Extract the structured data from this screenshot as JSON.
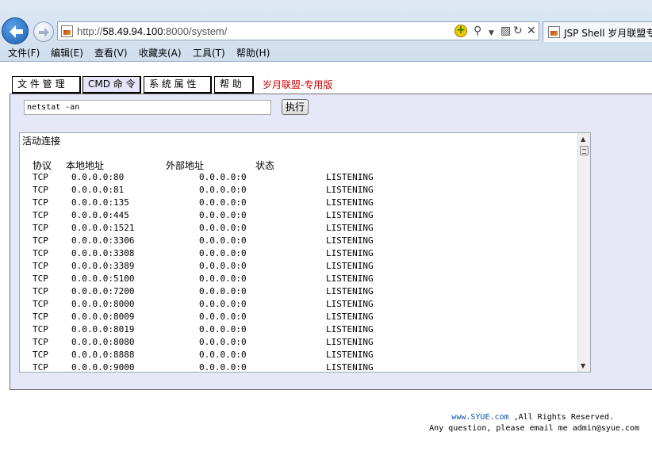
{
  "browser": {
    "url_prefix": "http://",
    "url_host": "58.49.94.100",
    "url_rest": ":8000/system/",
    "tab_title": "JSP Shell 岁月联盟专",
    "icons": [
      "back-arrow-icon",
      "forward-arrow-icon",
      "page-icon",
      "compat-view-icon",
      "search-icon",
      "dropdown-icon",
      "split-view-icon",
      "refresh-icon",
      "stop-icon"
    ]
  },
  "menu": [
    "文件(F)",
    "编辑(E)",
    "查看(V)",
    "收藏夹(A)",
    "工具(T)",
    "帮助(H)"
  ],
  "nav": {
    "items": [
      "文 件 管 理",
      "CMD 命 令",
      "系 统 属 性",
      "帮 助"
    ],
    "brand": "岁月联盟-专用版"
  },
  "command": {
    "value": "netstat -an",
    "run_label": "执行"
  },
  "output": {
    "title": "活动连接",
    "headers": [
      "协议",
      "本地地址",
      "外部地址",
      "状态"
    ],
    "rows": [
      [
        "TCP",
        "0.0.0.0:80",
        "0.0.0.0:0",
        "LISTENING"
      ],
      [
        "TCP",
        "0.0.0.0:81",
        "0.0.0.0:0",
        "LISTENING"
      ],
      [
        "TCP",
        "0.0.0.0:135",
        "0.0.0.0:0",
        "LISTENING"
      ],
      [
        "TCP",
        "0.0.0.0:445",
        "0.0.0.0:0",
        "LISTENING"
      ],
      [
        "TCP",
        "0.0.0.0:1521",
        "0.0.0.0:0",
        "LISTENING"
      ],
      [
        "TCP",
        "0.0.0.0:3306",
        "0.0.0.0:0",
        "LISTENING"
      ],
      [
        "TCP",
        "0.0.0.0:3308",
        "0.0.0.0:0",
        "LISTENING"
      ],
      [
        "TCP",
        "0.0.0.0:3389",
        "0.0.0.0:0",
        "LISTENING"
      ],
      [
        "TCP",
        "0.0.0.0:5100",
        "0.0.0.0:0",
        "LISTENING"
      ],
      [
        "TCP",
        "0.0.0.0:7200",
        "0.0.0.0:0",
        "LISTENING"
      ],
      [
        "TCP",
        "0.0.0.0:8000",
        "0.0.0.0:0",
        "LISTENING"
      ],
      [
        "TCP",
        "0.0.0.0:8009",
        "0.0.0.0:0",
        "LISTENING"
      ],
      [
        "TCP",
        "0.0.0.0:8019",
        "0.0.0.0:0",
        "LISTENING"
      ],
      [
        "TCP",
        "0.0.0.0:8080",
        "0.0.0.0:0",
        "LISTENING"
      ],
      [
        "TCP",
        "0.0.0.0:8888",
        "0.0.0.0:0",
        "LISTENING"
      ],
      [
        "TCP",
        "0.0.0.0:9000",
        "0.0.0.0:0",
        "LISTENING"
      ]
    ]
  },
  "footer": {
    "site": "www.SYUE.com",
    "rights": " ,All Rights Reserved.",
    "contact": "Any question, please email me admin@syue.com"
  },
  "colors": {
    "brand_red": "#cc0000",
    "panel_bg": "#e6e8f8",
    "link_blue": "#0055aa"
  }
}
